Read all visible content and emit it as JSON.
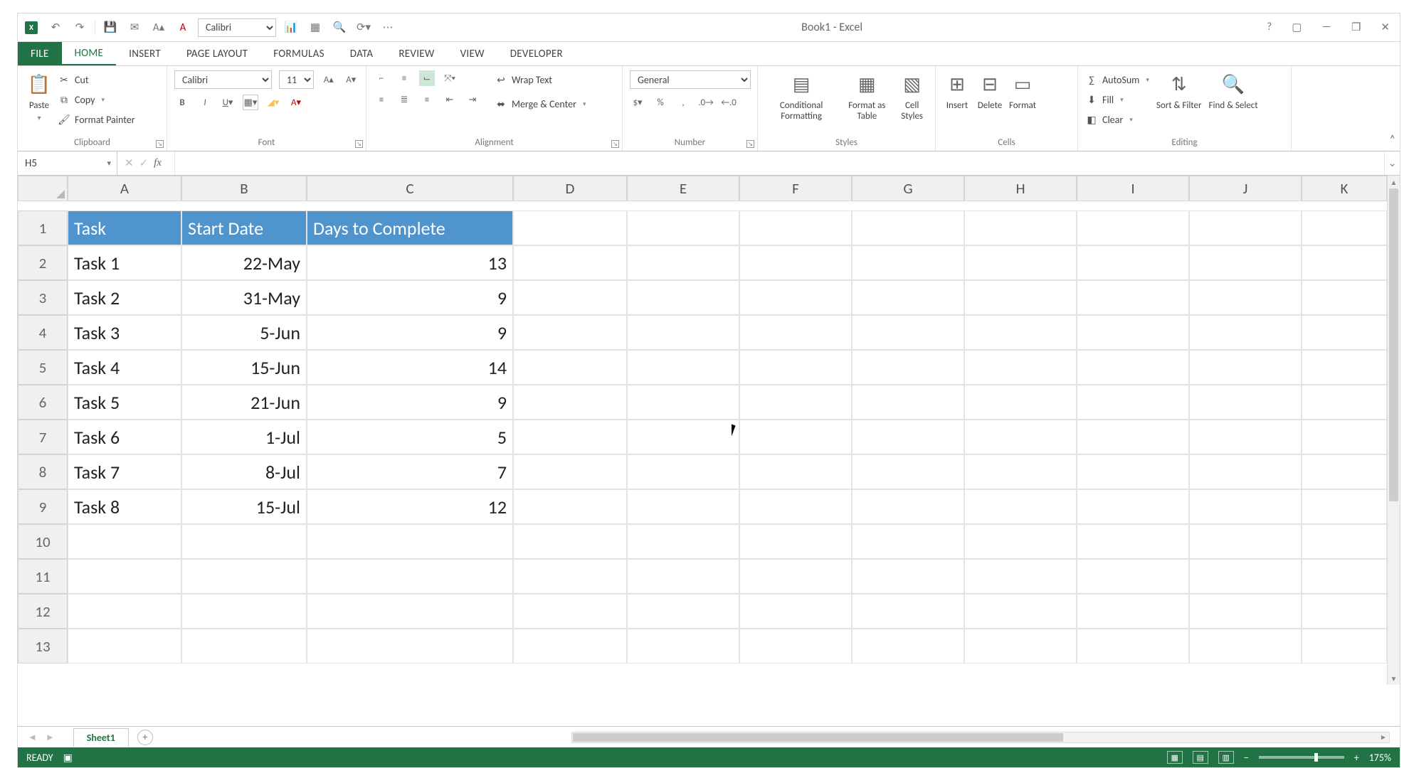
{
  "qat": {
    "title": "Book1 - Excel",
    "font_name": "Calibri"
  },
  "window": {
    "help": "?",
    "full": "▢",
    "min": "—",
    "max": "❐",
    "close": "✕"
  },
  "tabs": [
    "FILE",
    "HOME",
    "INSERT",
    "PAGE LAYOUT",
    "FORMULAS",
    "DATA",
    "REVIEW",
    "VIEW",
    "DEVELOPER"
  ],
  "ribbon": {
    "clipboard": {
      "paste": "Paste",
      "cut": "Cut",
      "copy": "Copy",
      "painter": "Format Painter",
      "label": "Clipboard"
    },
    "font": {
      "name": "Calibri",
      "size": "11",
      "label": "Font"
    },
    "alignment": {
      "wrap": "Wrap Text",
      "merge": "Merge & Center",
      "label": "Alignment"
    },
    "number": {
      "format": "General",
      "label": "Number"
    },
    "styles": {
      "cond": "Conditional Formatting",
      "fmt": "Format as Table",
      "cell": "Cell Styles",
      "label": "Styles"
    },
    "cells": {
      "insert": "Insert",
      "delete": "Delete",
      "format": "Format",
      "label": "Cells"
    },
    "editing": {
      "sum": "AutoSum",
      "fill": "Fill",
      "clear": "Clear",
      "sort": "Sort & Filter",
      "find": "Find & Select",
      "label": "Editing"
    }
  },
  "namebox": "H5",
  "formula": "",
  "columns": [
    "A",
    "B",
    "C",
    "D",
    "E",
    "F",
    "G",
    "H",
    "I",
    "J",
    "K"
  ],
  "rows": [
    "1",
    "2",
    "3",
    "4",
    "5",
    "6",
    "7",
    "8",
    "9",
    "10",
    "11",
    "12",
    "13"
  ],
  "chart_data": {
    "type": "table",
    "headers": [
      "Task",
      "Start Date",
      "Days to Complete"
    ],
    "rows": [
      [
        "Task 1",
        "22-May",
        "13"
      ],
      [
        "Task 2",
        "31-May",
        "9"
      ],
      [
        "Task 3",
        "5-Jun",
        "9"
      ],
      [
        "Task 4",
        "15-Jun",
        "14"
      ],
      [
        "Task 5",
        "21-Jun",
        "9"
      ],
      [
        "Task 6",
        "1-Jul",
        "5"
      ],
      [
        "Task 7",
        "8-Jul",
        "7"
      ],
      [
        "Task 8",
        "15-Jul",
        "12"
      ]
    ]
  },
  "sheet": {
    "name": "Sheet1"
  },
  "status": {
    "ready": "READY",
    "zoom": "175%"
  }
}
